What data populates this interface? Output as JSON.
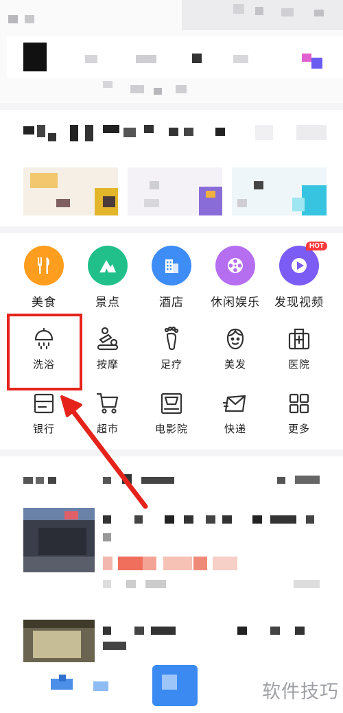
{
  "categories": [
    {
      "label": "美食",
      "icon": "fork-knife-icon",
      "color": "#ff9d1f"
    },
    {
      "label": "景点",
      "icon": "mountain-icon",
      "color": "#21c08a"
    },
    {
      "label": "酒店",
      "icon": "building-icon",
      "color": "#3e8cf5"
    },
    {
      "label": "休闲娱乐",
      "icon": "film-reel-icon",
      "color": "#b56ef0"
    },
    {
      "label": "发现视频",
      "icon": "play-icon",
      "color": "#7b5cf5",
      "badge": "HOT"
    }
  ],
  "services": [
    {
      "label": "洗浴",
      "icon": "shower-icon"
    },
    {
      "label": "按摩",
      "icon": "massage-icon"
    },
    {
      "label": "足疗",
      "icon": "foot-icon"
    },
    {
      "label": "美发",
      "icon": "face-icon"
    },
    {
      "label": "医院",
      "icon": "hospital-icon"
    },
    {
      "label": "银行",
      "icon": "bank-card-icon"
    },
    {
      "label": "超市",
      "icon": "cart-icon"
    },
    {
      "label": "电影院",
      "icon": "cinema-icon"
    },
    {
      "label": "快递",
      "icon": "express-envelope-icon"
    },
    {
      "label": "更多",
      "icon": "grid-icon"
    }
  ],
  "watermark": "软件技巧",
  "colors": {
    "highlight": "#e5231b",
    "accent": "#3e8cf5"
  }
}
